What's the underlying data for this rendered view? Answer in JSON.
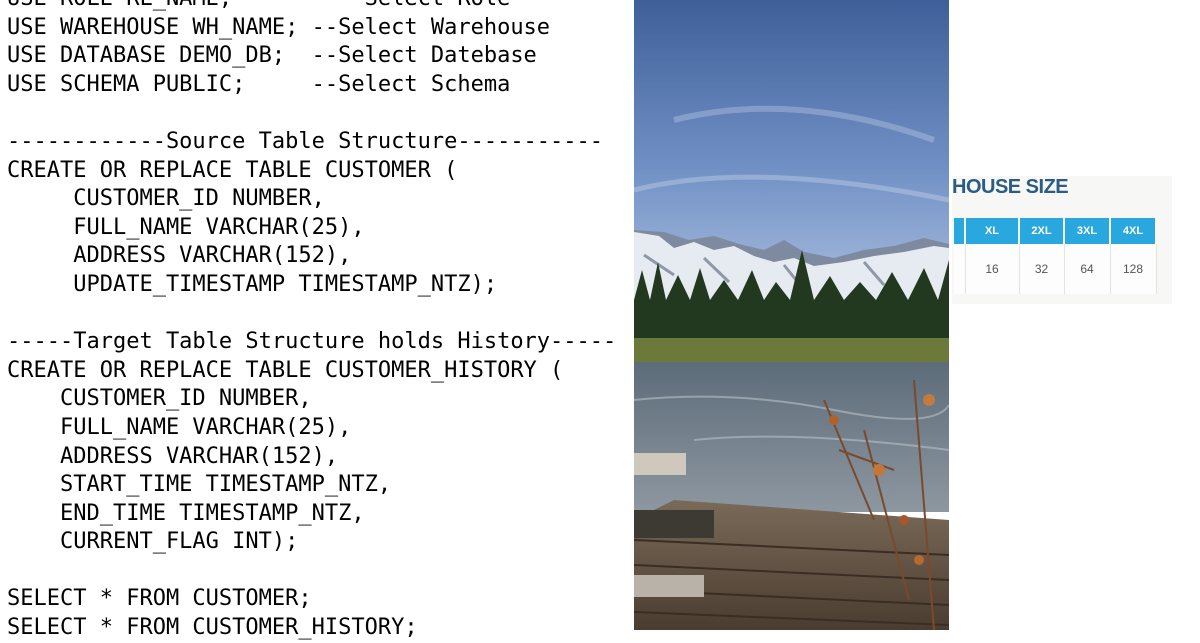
{
  "code": {
    "lines": [
      "USE ROLE RL_NAME;        --Select Role",
      "USE WAREHOUSE WH_NAME; --Select Warehouse",
      "USE DATABASE DEMO_DB;  --Select Datebase",
      "USE SCHEMA PUBLIC;     --Select Schema",
      "",
      "------------Source Table Structure-----------",
      "CREATE OR REPLACE TABLE CUSTOMER (",
      "     CUSTOMER_ID NUMBER,",
      "     FULL_NAME VARCHAR(25),",
      "     ADDRESS VARCHAR(152),",
      "     UPDATE_TIMESTAMP TIMESTAMP_NTZ);",
      "",
      "-----Target Table Structure holds History-----",
      "CREATE OR REPLACE TABLE CUSTOMER_HISTORY (",
      "    CUSTOMER_ID NUMBER,",
      "    FULL_NAME VARCHAR(25),",
      "    ADDRESS VARCHAR(152),",
      "    START_TIME TIMESTAMP_NTZ,",
      "    END_TIME TIMESTAMP_NTZ,",
      "    CURRENT_FLAG INT);",
      "",
      "SELECT * FROM CUSTOMER;",
      "SELECT * FROM CUSTOMER_HISTORY;"
    ]
  },
  "photo": {
    "subject": "mountain-lake-landscape"
  },
  "warehouse_size": {
    "title": "HOUSE SIZE",
    "header_color": "#29a8e0",
    "title_color": "#2b5c86",
    "columns": [
      "XL",
      "2XL",
      "3XL",
      "4XL"
    ],
    "values": [
      "16",
      "32",
      "64",
      "128"
    ]
  }
}
